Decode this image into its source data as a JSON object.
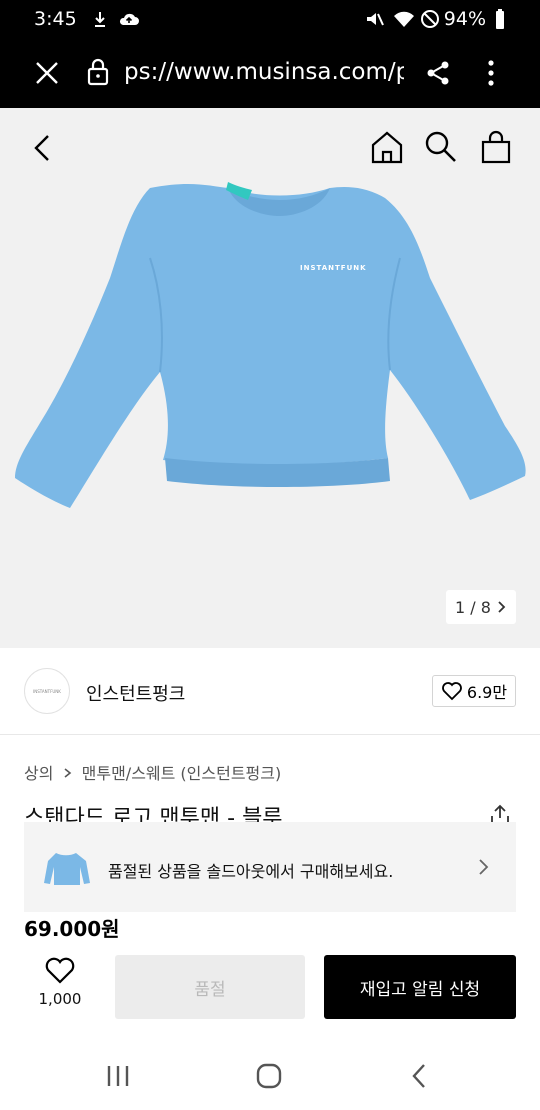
{
  "status_bar": {
    "time": "3:45",
    "battery": "94%"
  },
  "browser": {
    "url": "ps://www.musinsa.com/p"
  },
  "gallery": {
    "counter": "1 / 8",
    "print_text": "INSTANTFUNK"
  },
  "brand": {
    "logo_text": "INSTANTFUNK",
    "name": "인스턴트펑크",
    "likes": "6.9만"
  },
  "breadcrumb": {
    "category": "상의",
    "subcategory": "맨투맨/스웨트 (인스턴트펑크)"
  },
  "product": {
    "title": "스탠다드 로고 맨투맨 - 블루",
    "price": "69.000원"
  },
  "soldout_banner": {
    "text": "품절된 상품을 솔드아웃에서 구매해보세요."
  },
  "bottom_bar": {
    "wish_count": "1,000",
    "soldout_label": "품절",
    "restock_label": "재입고 알림 신청"
  },
  "colors": {
    "product": "#7bb8e6",
    "accent": "#000000"
  }
}
